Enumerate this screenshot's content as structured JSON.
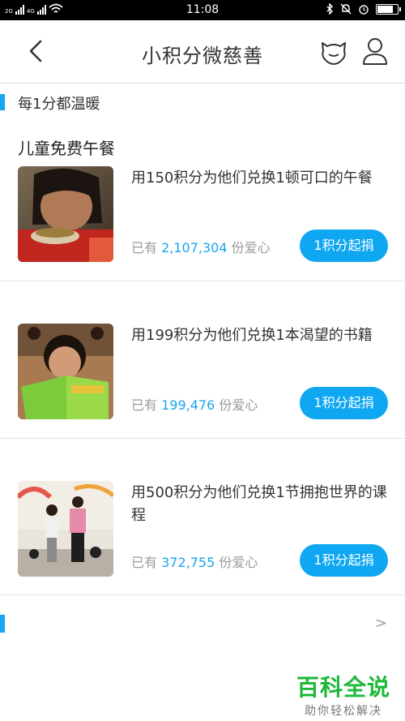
{
  "status_bar": {
    "net1": "2G",
    "net2": "4G",
    "time": "11:08",
    "battery_level": 0.85
  },
  "header": {
    "title": "小积分微慈善"
  },
  "section": {
    "label": "每1分都温暖"
  },
  "category": {
    "title": "儿童免费午餐"
  },
  "items": [
    {
      "description": "用150积分为他们兑换1顿可口的午餐",
      "stat_prefix": "已有",
      "count": "2,107,304",
      "stat_suffix": "份爱心",
      "button_label": "1积分起捐"
    },
    {
      "description": "用199积分为他们兑换1本渴望的书籍",
      "stat_prefix": "已有",
      "count": "199,476",
      "stat_suffix": "份爱心",
      "button_label": "1积分起捐"
    },
    {
      "description": "用500积分为他们兑换1节拥抱世界的课程",
      "stat_prefix": "已有",
      "count": "372,755",
      "stat_suffix": "份爱心",
      "button_label": "1积分起捐"
    }
  ],
  "bottom": {
    "chevron": ">"
  },
  "watermark": {
    "main": "百科全说",
    "sub": "助你轻松解决"
  },
  "colors": {
    "accent": "#1aa5f0",
    "button": "#0fa7f2",
    "watermark_green": "#1db839"
  }
}
